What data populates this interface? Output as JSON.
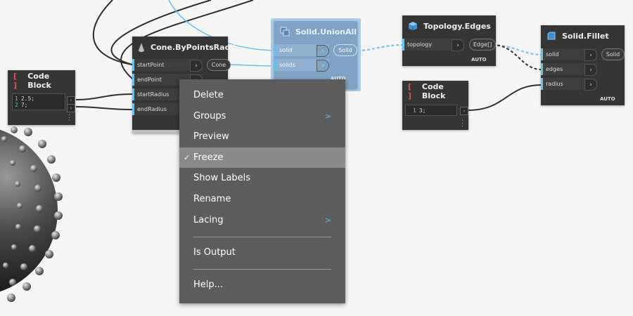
{
  "colors": {
    "wire_blue": "#6ac0e7",
    "node_bg": "#353535",
    "menu_bg": "#5d5d5d",
    "menu_highlight": "#8a8a8a",
    "selected_border": "#9bc4ea"
  },
  "nodes": {
    "code_block_1": {
      "title": "Code Block",
      "lines": [
        {
          "num": "1",
          "text": "2.5;"
        },
        {
          "num": "2",
          "text": "7;"
        }
      ]
    },
    "cone": {
      "title": "Cone.ByPointsRadii",
      "inputs": [
        "startPoint",
        "endPoint",
        "startRadius",
        "endRadius"
      ],
      "output": "Cone"
    },
    "union": {
      "title": "Solid.UnionAll",
      "inputs": [
        "solid",
        "solids"
      ],
      "output": "Solid",
      "lacing": "AUTO"
    },
    "edges": {
      "title": "Topology.Edges",
      "inputs": [
        "topology"
      ],
      "output": "Edge[]",
      "lacing": "AUTO"
    },
    "code_block_2": {
      "title": "Code Block",
      "lines": [
        {
          "num": "1",
          "text": "3;"
        }
      ]
    },
    "fillet": {
      "title": "Solid.Fillet",
      "inputs": [
        "solid",
        "edges",
        "radius"
      ],
      "output": "Solid",
      "lacing": "AUTO"
    }
  },
  "context_menu": {
    "items": [
      {
        "label": "Delete"
      },
      {
        "label": "Groups",
        "submenu": true
      },
      {
        "label": "Preview"
      },
      {
        "label": "Freeze",
        "checked": true,
        "highlighted": true
      },
      {
        "label": "Show Labels"
      },
      {
        "label": "Rename"
      },
      {
        "label": "Lacing",
        "submenu": true
      },
      {
        "label": "Is Output"
      },
      {
        "label": "Help..."
      }
    ]
  },
  "icons": {
    "code_block": "code-bracket-icon",
    "cone": "cone-icon",
    "union": "union-icon",
    "edges": "cube-icon",
    "fillet": "fillet-icon",
    "submenu": "chevron-right-icon",
    "check": "checkmark-icon"
  }
}
